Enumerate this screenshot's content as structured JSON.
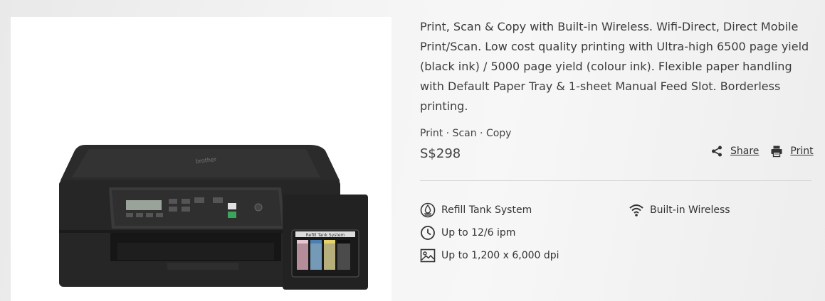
{
  "product": {
    "description": "Print, Scan & Copy with Built-in Wireless. Wifi-Direct, Direct Mobile Print/Scan. Low cost quality printing with Ultra-high 6500 page yield (black ink) / 5000 page yield (colour ink). Flexible paper handling with Default Paper Tray & 1-sheet Manual Feed Slot. Borderless printing.",
    "functions": "Print · Scan · Copy",
    "price": "S$298"
  },
  "actions": {
    "share_label": "Share",
    "print_label": "Print"
  },
  "features": [
    {
      "label": "Refill Tank System",
      "icon": "refill-tank-icon"
    },
    {
      "label": "Built-in Wireless",
      "icon": "wifi-icon"
    },
    {
      "label": "Up to 12/6 ipm",
      "icon": "clock-icon"
    },
    {
      "label": "Up to 1,200 x 6,000 dpi",
      "icon": "image-icon"
    }
  ],
  "printer_image": {
    "brand_text": "brother",
    "tank_label": "Refill Tank System"
  },
  "colors": {
    "printer_body": "#2a2a2a",
    "ink_black": "#4b4b4b",
    "ink_cyan": "#7fa9c9",
    "ink_magenta": "#c69aa8",
    "ink_yellow": "#c8bf86"
  }
}
